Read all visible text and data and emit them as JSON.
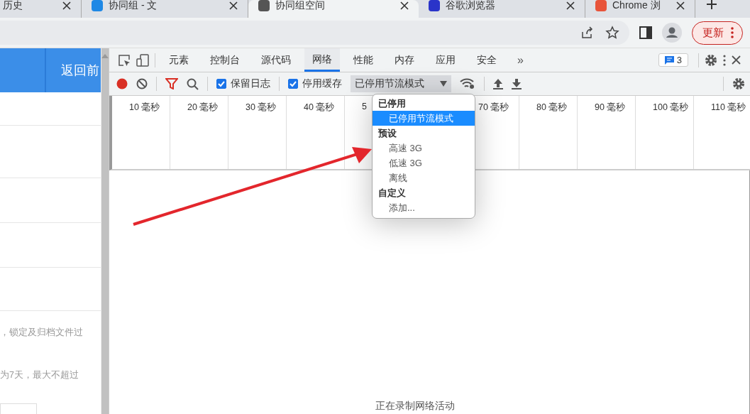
{
  "browser": {
    "tabs": [
      {
        "title": "历史",
        "selected": false
      },
      {
        "title": "协同组 - 文",
        "selected": false
      },
      {
        "title": "协同组空间",
        "selected": true
      },
      {
        "title": "谷歌浏览器",
        "selected": false
      },
      {
        "title": "Chrome 浏",
        "selected": false
      }
    ],
    "update_button": "更新"
  },
  "page": {
    "header_link": "返回前",
    "notes": [
      "，锁定及归档文件过",
      "为7天，最大不超过"
    ]
  },
  "devtools": {
    "tabs": [
      {
        "label": "元素",
        "selected": false
      },
      {
        "label": "控制台",
        "selected": false
      },
      {
        "label": "源代码",
        "selected": false
      },
      {
        "label": "网络",
        "selected": true
      },
      {
        "label": "性能",
        "selected": false
      },
      {
        "label": "内存",
        "selected": false
      },
      {
        "label": "应用",
        "selected": false
      },
      {
        "label": "安全",
        "selected": false
      }
    ],
    "more": "»",
    "issues_count": "3",
    "toolbar": {
      "preserve_log": {
        "label": "保留日志",
        "checked": true
      },
      "disable_cache": {
        "label": "停用缓存",
        "checked": true
      },
      "throttling": "已停用节流模式"
    },
    "ticks": [
      "10 毫秒",
      "20 毫秒",
      "30 毫秒",
      "40 毫秒",
      "5",
      "70 毫秒",
      "80 毫秒",
      "90 毫秒",
      "100 毫秒",
      "110 毫秒"
    ],
    "throttle_menu": [
      {
        "heading": "已停用",
        "items": [
          {
            "label": "已停用节流模式",
            "selected": true
          }
        ]
      },
      {
        "heading": "预设",
        "items": [
          {
            "label": "高速 3G",
            "selected": false
          },
          {
            "label": "低速 3G",
            "selected": false
          },
          {
            "label": "离线",
            "selected": false
          }
        ]
      },
      {
        "heading": "自定义",
        "items": [
          {
            "label": "添加...",
            "selected": false
          }
        ]
      }
    ],
    "status": "正在录制网络活动"
  }
}
